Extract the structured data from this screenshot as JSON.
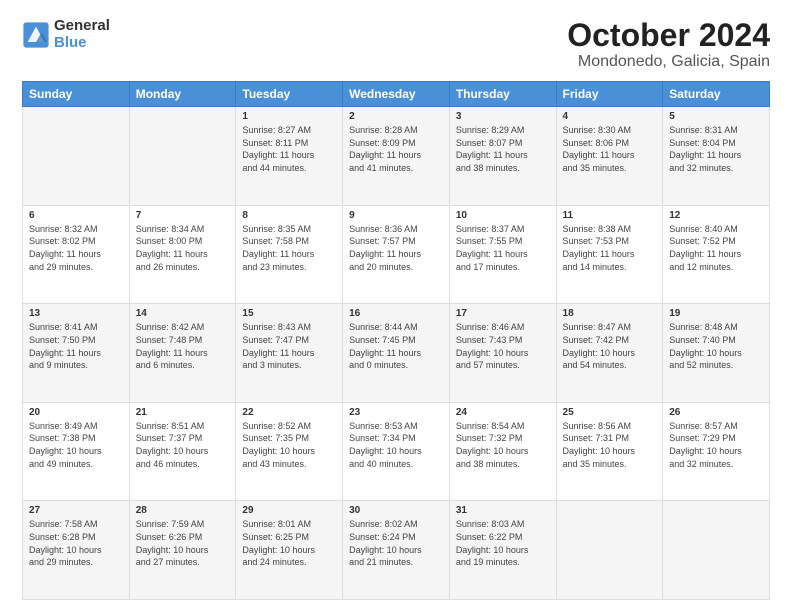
{
  "header": {
    "logo_line1": "General",
    "logo_line2": "Blue",
    "title": "October 2024",
    "subtitle": "Mondonedo, Galicia, Spain"
  },
  "weekdays": [
    "Sunday",
    "Monday",
    "Tuesday",
    "Wednesday",
    "Thursday",
    "Friday",
    "Saturday"
  ],
  "rows": [
    [
      {
        "day": "",
        "content": ""
      },
      {
        "day": "",
        "content": ""
      },
      {
        "day": "1",
        "content": "Sunrise: 8:27 AM\nSunset: 8:11 PM\nDaylight: 11 hours\nand 44 minutes."
      },
      {
        "day": "2",
        "content": "Sunrise: 8:28 AM\nSunset: 8:09 PM\nDaylight: 11 hours\nand 41 minutes."
      },
      {
        "day": "3",
        "content": "Sunrise: 8:29 AM\nSunset: 8:07 PM\nDaylight: 11 hours\nand 38 minutes."
      },
      {
        "day": "4",
        "content": "Sunrise: 8:30 AM\nSunset: 8:06 PM\nDaylight: 11 hours\nand 35 minutes."
      },
      {
        "day": "5",
        "content": "Sunrise: 8:31 AM\nSunset: 8:04 PM\nDaylight: 11 hours\nand 32 minutes."
      }
    ],
    [
      {
        "day": "6",
        "content": "Sunrise: 8:32 AM\nSunset: 8:02 PM\nDaylight: 11 hours\nand 29 minutes."
      },
      {
        "day": "7",
        "content": "Sunrise: 8:34 AM\nSunset: 8:00 PM\nDaylight: 11 hours\nand 26 minutes."
      },
      {
        "day": "8",
        "content": "Sunrise: 8:35 AM\nSunset: 7:58 PM\nDaylight: 11 hours\nand 23 minutes."
      },
      {
        "day": "9",
        "content": "Sunrise: 8:36 AM\nSunset: 7:57 PM\nDaylight: 11 hours\nand 20 minutes."
      },
      {
        "day": "10",
        "content": "Sunrise: 8:37 AM\nSunset: 7:55 PM\nDaylight: 11 hours\nand 17 minutes."
      },
      {
        "day": "11",
        "content": "Sunrise: 8:38 AM\nSunset: 7:53 PM\nDaylight: 11 hours\nand 14 minutes."
      },
      {
        "day": "12",
        "content": "Sunrise: 8:40 AM\nSunset: 7:52 PM\nDaylight: 11 hours\nand 12 minutes."
      }
    ],
    [
      {
        "day": "13",
        "content": "Sunrise: 8:41 AM\nSunset: 7:50 PM\nDaylight: 11 hours\nand 9 minutes."
      },
      {
        "day": "14",
        "content": "Sunrise: 8:42 AM\nSunset: 7:48 PM\nDaylight: 11 hours\nand 6 minutes."
      },
      {
        "day": "15",
        "content": "Sunrise: 8:43 AM\nSunset: 7:47 PM\nDaylight: 11 hours\nand 3 minutes."
      },
      {
        "day": "16",
        "content": "Sunrise: 8:44 AM\nSunset: 7:45 PM\nDaylight: 11 hours\nand 0 minutes."
      },
      {
        "day": "17",
        "content": "Sunrise: 8:46 AM\nSunset: 7:43 PM\nDaylight: 10 hours\nand 57 minutes."
      },
      {
        "day": "18",
        "content": "Sunrise: 8:47 AM\nSunset: 7:42 PM\nDaylight: 10 hours\nand 54 minutes."
      },
      {
        "day": "19",
        "content": "Sunrise: 8:48 AM\nSunset: 7:40 PM\nDaylight: 10 hours\nand 52 minutes."
      }
    ],
    [
      {
        "day": "20",
        "content": "Sunrise: 8:49 AM\nSunset: 7:38 PM\nDaylight: 10 hours\nand 49 minutes."
      },
      {
        "day": "21",
        "content": "Sunrise: 8:51 AM\nSunset: 7:37 PM\nDaylight: 10 hours\nand 46 minutes."
      },
      {
        "day": "22",
        "content": "Sunrise: 8:52 AM\nSunset: 7:35 PM\nDaylight: 10 hours\nand 43 minutes."
      },
      {
        "day": "23",
        "content": "Sunrise: 8:53 AM\nSunset: 7:34 PM\nDaylight: 10 hours\nand 40 minutes."
      },
      {
        "day": "24",
        "content": "Sunrise: 8:54 AM\nSunset: 7:32 PM\nDaylight: 10 hours\nand 38 minutes."
      },
      {
        "day": "25",
        "content": "Sunrise: 8:56 AM\nSunset: 7:31 PM\nDaylight: 10 hours\nand 35 minutes."
      },
      {
        "day": "26",
        "content": "Sunrise: 8:57 AM\nSunset: 7:29 PM\nDaylight: 10 hours\nand 32 minutes."
      }
    ],
    [
      {
        "day": "27",
        "content": "Sunrise: 7:58 AM\nSunset: 6:28 PM\nDaylight: 10 hours\nand 29 minutes."
      },
      {
        "day": "28",
        "content": "Sunrise: 7:59 AM\nSunset: 6:26 PM\nDaylight: 10 hours\nand 27 minutes."
      },
      {
        "day": "29",
        "content": "Sunrise: 8:01 AM\nSunset: 6:25 PM\nDaylight: 10 hours\nand 24 minutes."
      },
      {
        "day": "30",
        "content": "Sunrise: 8:02 AM\nSunset: 6:24 PM\nDaylight: 10 hours\nand 21 minutes."
      },
      {
        "day": "31",
        "content": "Sunrise: 8:03 AM\nSunset: 6:22 PM\nDaylight: 10 hours\nand 19 minutes."
      },
      {
        "day": "",
        "content": ""
      },
      {
        "day": "",
        "content": ""
      }
    ]
  ]
}
